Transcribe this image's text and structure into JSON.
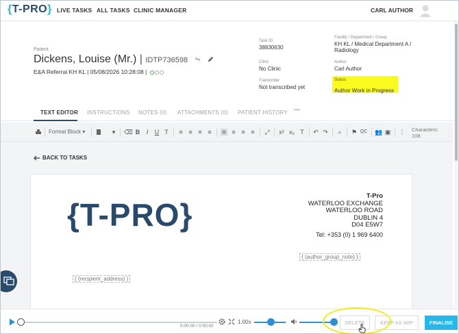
{
  "nav": {
    "logo": "T-PRO",
    "links": [
      "LIVE TASKS",
      "ALL TASKS",
      "CLINIC MANAGER"
    ],
    "user": "CARL AUTHOR"
  },
  "patient": {
    "label": "Patient",
    "name": "Dickens, Louise (Mr.)",
    "id": "IDTP736598",
    "referral": "E&A Referral KH KL | 05/08/2026 10:28:08 |"
  },
  "meta": {
    "task_id_label": "Task ID",
    "task_id": "38830630",
    "clinic_label": "Clinic",
    "clinic": "No Clinic",
    "transcriber_label": "Transcriber",
    "transcriber": "Not transcribed yet",
    "facility_label": "Facility / Department / Group",
    "facility": "KH KL / Medical Department A / Radiology",
    "author_label": "Author",
    "author": "Carl Author",
    "status_label": "Status",
    "status": "Author Work in Progress"
  },
  "tabs": [
    "TEXT EDITOR",
    "INSTRUCTIONS",
    "NOTES (0)",
    "ATTACHMENTS (0)",
    "PATIENT HISTORY",
    "•••"
  ],
  "toolbar": {
    "format_block": "Format Block",
    "qc": "QC",
    "characters_label": "Characters:",
    "characters": "108"
  },
  "back_link": "BACK TO TASKS",
  "document": {
    "logo": "T-PRO",
    "address": [
      "T-Pro",
      "WATERLOO EXCHANGE",
      "WATERLOO ROAD",
      "DUBLIN 4",
      "D04 E5W7"
    ],
    "phone": "Tel: +353 (0) 1 969 6400",
    "author_group_placeholder": "{ {author_group_note} }",
    "recipient_placeholder": "{ {recipient_address} }"
  },
  "audio": {
    "timecode": "0:00:00 / 0:00:00",
    "speed": "1.00x",
    "progress": 0,
    "speed_level": 0.45,
    "volume_level": 0.9
  },
  "actions": {
    "delete": "DELETE",
    "keep_wip": "KEEP AS WIP",
    "finalise": "FINALISE"
  },
  "colors": {
    "brand": "#2a4a6b",
    "accent": "#29b6e8",
    "status_highlight": "#fafa1e"
  }
}
